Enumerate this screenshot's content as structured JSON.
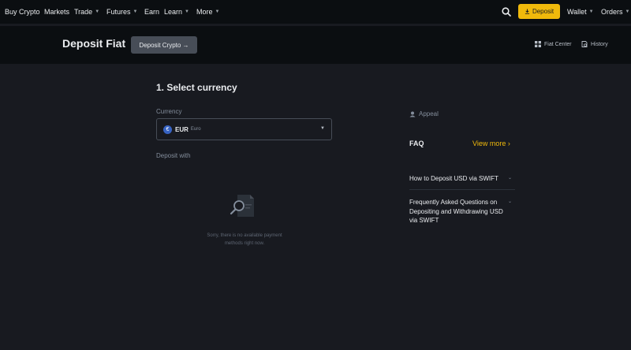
{
  "nav": {
    "items": [
      {
        "label": "Buy Crypto",
        "caret": false
      },
      {
        "label": "Markets",
        "caret": false
      },
      {
        "label": "Trade",
        "caret": true
      },
      {
        "label": "Futures",
        "caret": true
      },
      {
        "label": "Earn",
        "caret": false
      },
      {
        "label": "Learn",
        "caret": true
      },
      {
        "label": "More",
        "caret": true
      }
    ],
    "deposit_label": "Deposit",
    "wallet_label": "Wallet",
    "orders_label": "Orders",
    "caret_glyph": "▼"
  },
  "header": {
    "title": "Deposit Fiat",
    "crypto_button": "Deposit Crypto →",
    "fiat_center": "Fiat Center",
    "history": "History"
  },
  "main": {
    "section_title": "1. Select currency",
    "currency_label": "Currency",
    "currency": {
      "symbol": "€",
      "code": "EUR",
      "name": "Euro"
    },
    "deposit_with_label": "Deposit with",
    "empty_line1": "Sorry, there is no available payment",
    "empty_line2": "methods right now."
  },
  "sidebar": {
    "appeal": "Appeal",
    "faq_title": "FAQ",
    "view_more": "View more ›",
    "faqs": [
      {
        "q": "How to Deposit USD via SWIFT"
      },
      {
        "q": "Frequently Asked Questions on Depositing and Withdrawing USD via SWIFT"
      }
    ],
    "chevron_glyph": "⌄"
  },
  "colors": {
    "accent": "#f0b90b",
    "background": "#181a20",
    "nav_background": "#0b0e11"
  }
}
